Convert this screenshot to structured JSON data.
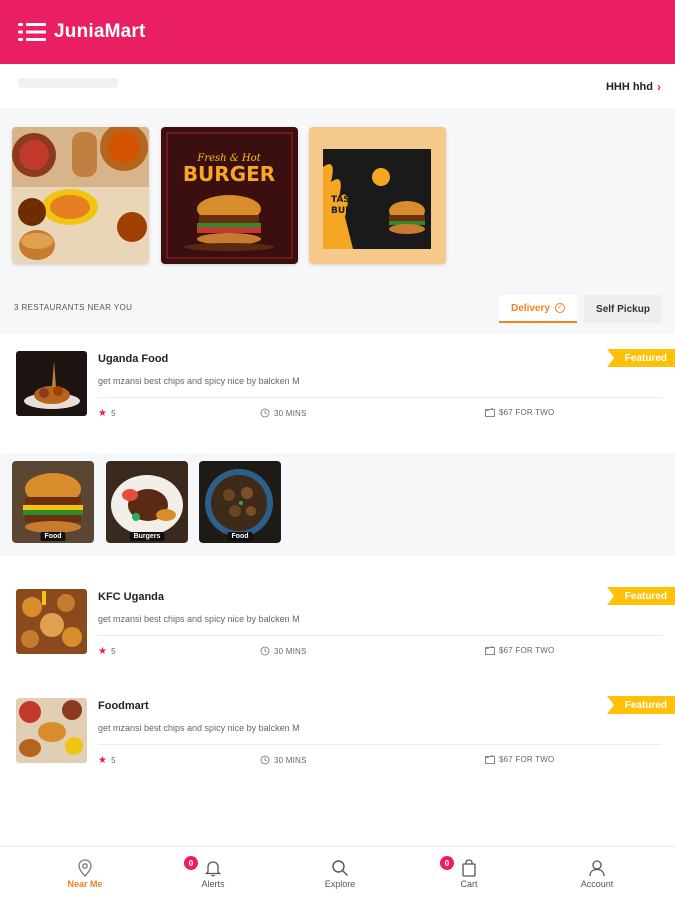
{
  "app": {
    "title": "JuniaMart"
  },
  "location": {
    "name": "HHH hhd"
  },
  "restaurants_count_label": "3 RESTAURANTS NEAR YOU",
  "mode_tabs": {
    "delivery": "Delivery",
    "pickup": "Self Pickup",
    "active": "Delivery"
  },
  "restaurants": [
    {
      "name": "Uganda Food",
      "description": "get mzansi best chips and spicy nice by balcken M",
      "rating": "5",
      "time": "30 MINS",
      "price": "$67 FOR TWO",
      "badge": "Featured"
    },
    {
      "name": "KFC Uganda",
      "description": "get mzansi best chips and spicy nice by balcken M",
      "rating": "5",
      "time": "30 MINS",
      "price": "$67 FOR TWO",
      "badge": "Featured"
    },
    {
      "name": "Foodmart",
      "description": "get mzansi best chips and spicy nice by balcken M",
      "rating": "5",
      "time": "30 MINS",
      "price": "$67 FOR TWO",
      "badge": "Featured"
    }
  ],
  "categories": [
    {
      "label": "Food"
    },
    {
      "label": "Burgers"
    },
    {
      "label": "Food"
    }
  ],
  "bottom_nav": [
    {
      "label": "Near Me",
      "icon": "location-pin-icon",
      "active": true
    },
    {
      "label": "Alerts",
      "icon": "bell-icon",
      "badge": "0"
    },
    {
      "label": "Explore",
      "icon": "search-icon"
    },
    {
      "label": "Cart",
      "icon": "shopping-bag-icon",
      "badge": "0"
    },
    {
      "label": "Account",
      "icon": "user-icon"
    }
  ],
  "colors": {
    "brand": "#e91e63",
    "accent": "#f4811f",
    "featured": "#ffc107"
  }
}
